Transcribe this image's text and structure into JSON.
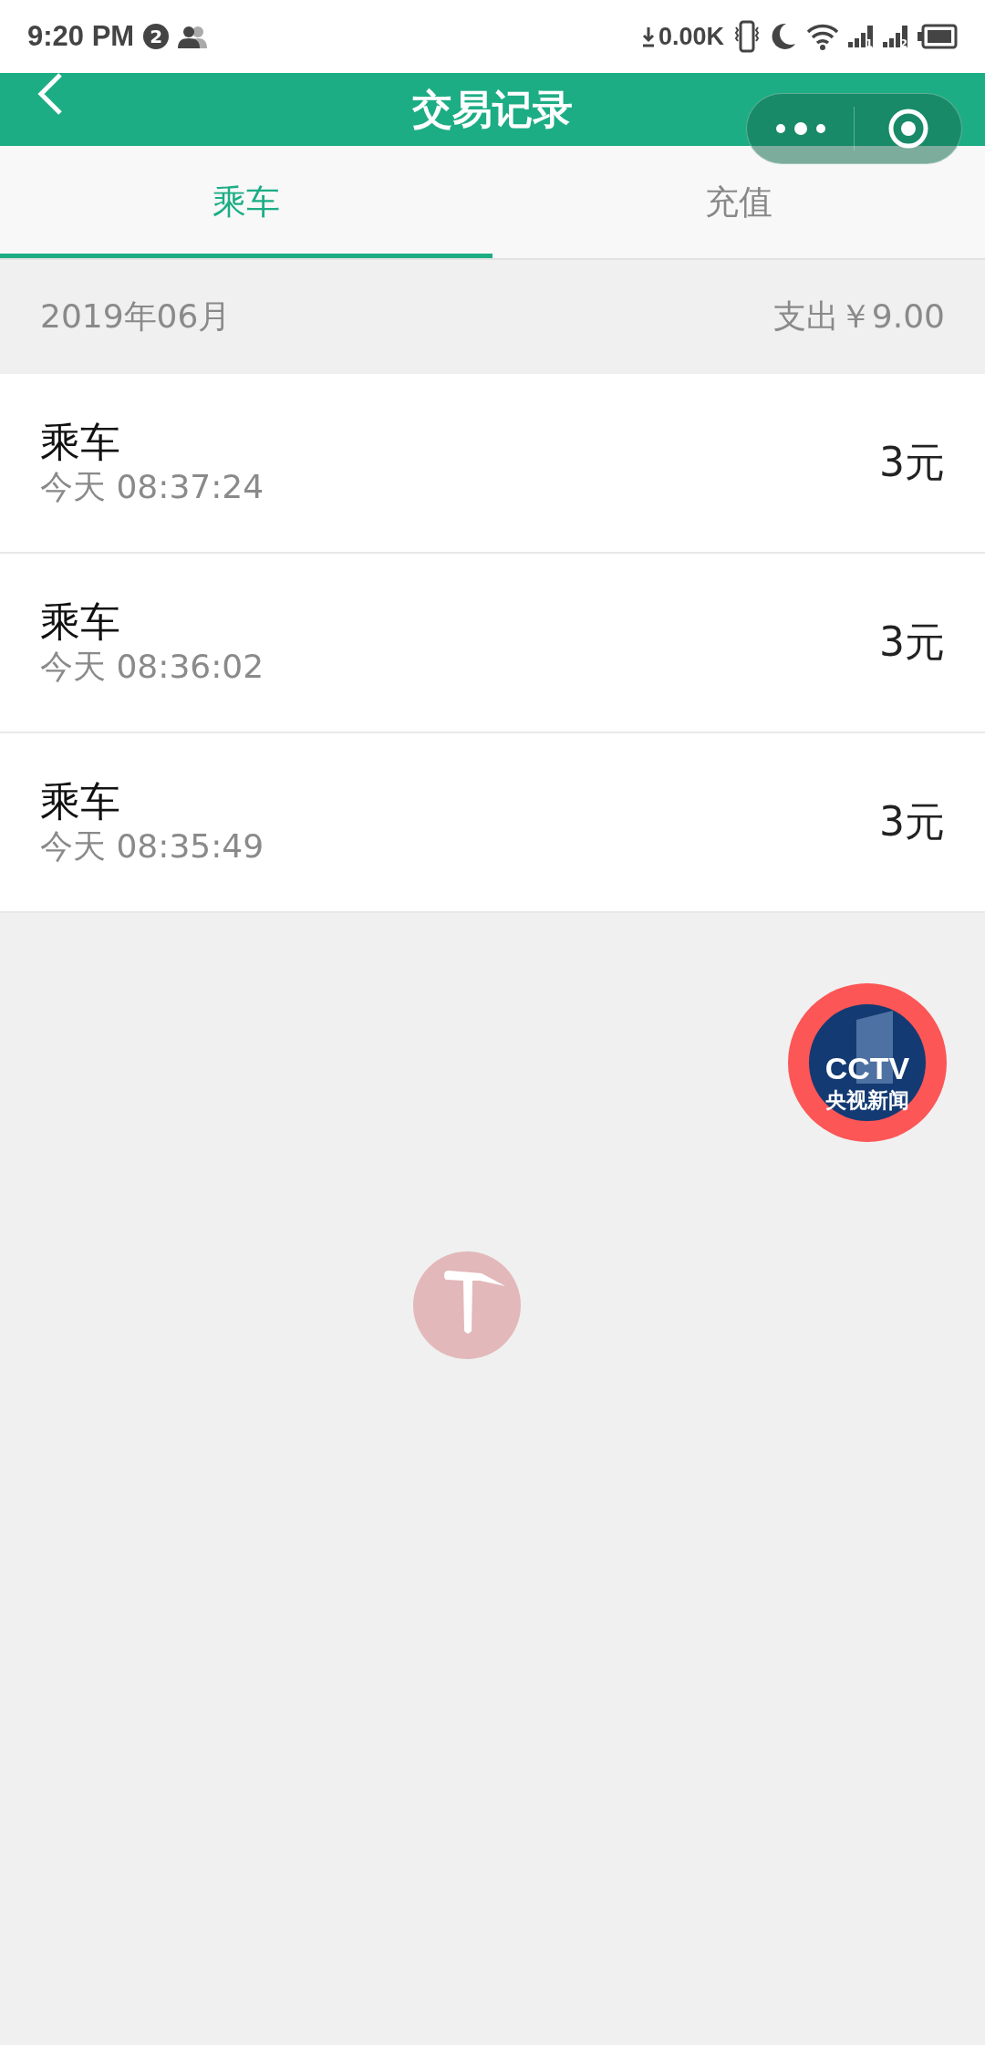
{
  "status_bar": {
    "time": "9:20 PM",
    "notification_count": "2",
    "network_speed": "0.00K",
    "sim_1": "1",
    "sim_2": "2"
  },
  "header": {
    "title": "交易记录"
  },
  "tabs": [
    {
      "label": "乘车",
      "selected": true
    },
    {
      "label": "充值",
      "selected": false
    }
  ],
  "month": {
    "label": "2019年06月",
    "summary": "支出￥9.00"
  },
  "records": [
    {
      "title": "乘车",
      "time": "今天 08:37:24",
      "amount": "3元"
    },
    {
      "title": "乘车",
      "time": "今天 08:36:02",
      "amount": "3元"
    },
    {
      "title": "乘车",
      "time": "今天 08:35:49",
      "amount": "3元"
    }
  ],
  "floating_badge": {
    "logo": "CCTV",
    "caption": "央视新闻"
  }
}
